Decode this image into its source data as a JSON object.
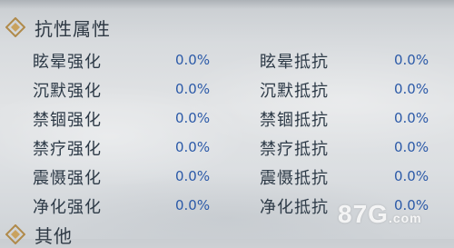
{
  "sections": {
    "resistance_title": "抗性属性",
    "other_title": "其他"
  },
  "rows": [
    {
      "left_label": "眩晕强化",
      "left_value": "0.0%",
      "right_label": "眩晕抵抗",
      "right_value": "0.0%"
    },
    {
      "left_label": "沉默强化",
      "left_value": "0.0%",
      "right_label": "沉默抵抗",
      "right_value": "0.0%"
    },
    {
      "left_label": "禁锢强化",
      "left_value": "0.0%",
      "right_label": "禁锢抵抗",
      "right_value": "0.0%"
    },
    {
      "left_label": "禁疗强化",
      "left_value": "0.0%",
      "right_label": "禁疗抵抗",
      "right_value": "0.0%"
    },
    {
      "left_label": "震慑强化",
      "left_value": "0.0%",
      "right_label": "震慑抵抗",
      "right_value": "0.0%"
    },
    {
      "left_label": "净化强化",
      "left_value": "0.0%",
      "right_label": "净化抵抗",
      "right_value": "0.0%"
    }
  ],
  "watermark": {
    "main": "87G",
    "suffix": ".com"
  },
  "colors": {
    "value_text": "#2c5aa8",
    "label_text": "#2d3a47",
    "icon_gold": "#b08a4a"
  },
  "icons": {
    "section_marker": "diamond-icon"
  }
}
